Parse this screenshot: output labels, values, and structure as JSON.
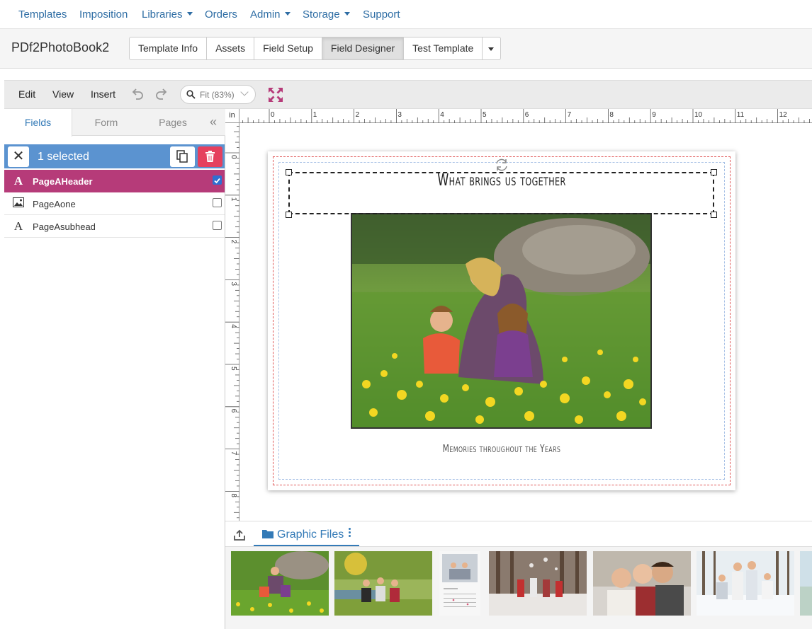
{
  "topnav": {
    "items": [
      {
        "label": "Templates",
        "dropdown": false
      },
      {
        "label": "Imposition",
        "dropdown": false
      },
      {
        "label": "Libraries",
        "dropdown": true
      },
      {
        "label": "Orders",
        "dropdown": false
      },
      {
        "label": "Admin",
        "dropdown": true
      },
      {
        "label": "Storage",
        "dropdown": true
      },
      {
        "label": "Support",
        "dropdown": false
      }
    ]
  },
  "project": {
    "title": "PDf2PhotoBook2"
  },
  "tabs": [
    {
      "label": "Template Info",
      "active": false
    },
    {
      "label": "Assets",
      "active": false
    },
    {
      "label": "Field Setup",
      "active": false
    },
    {
      "label": "Field Designer",
      "active": true
    },
    {
      "label": "Test Template",
      "active": false
    }
  ],
  "toolbar": {
    "menus": [
      "Edit",
      "View",
      "Insert"
    ],
    "zoom_label": "Fit (83%)",
    "icons": [
      "undo-icon",
      "redo-icon",
      "search-icon",
      "fullscreen-icon"
    ],
    "accent_color": "#b63b79"
  },
  "panel": {
    "tabs": [
      {
        "label": "Fields",
        "active": true
      },
      {
        "label": "Form",
        "active": false
      },
      {
        "label": "Pages",
        "active": false
      }
    ],
    "collapse_icon": "«",
    "selection": {
      "close_icon": "✕",
      "text": "1 selected"
    },
    "fields": [
      {
        "name": "PageAHeader",
        "type": "text",
        "icon": "A",
        "selected": true
      },
      {
        "name": "PageAone",
        "type": "image",
        "icon": "image-icon",
        "selected": false
      },
      {
        "name": "PageAsubhead",
        "type": "text",
        "icon": "A",
        "selected": false
      }
    ]
  },
  "ruler": {
    "unit": "in",
    "top_ticks": [
      "0",
      "1",
      "2",
      "3",
      "4",
      "5",
      "6",
      "7",
      "8",
      "9",
      "10",
      "11",
      "12"
    ],
    "left_ticks": [
      "0",
      "1",
      "2",
      "3",
      "4",
      "5",
      "6",
      "7",
      "8"
    ]
  },
  "page": {
    "header_text": "What brings us together",
    "subhead_text": "Memories throughout the Years"
  },
  "bottom": {
    "tab_label": "Graphic Files",
    "thumbnail_count": 8
  },
  "colors": {
    "link": "#2e6da4",
    "selection_bar": "#5b93d0",
    "selected_row": "#b63b79",
    "delete": "#e5405e"
  }
}
